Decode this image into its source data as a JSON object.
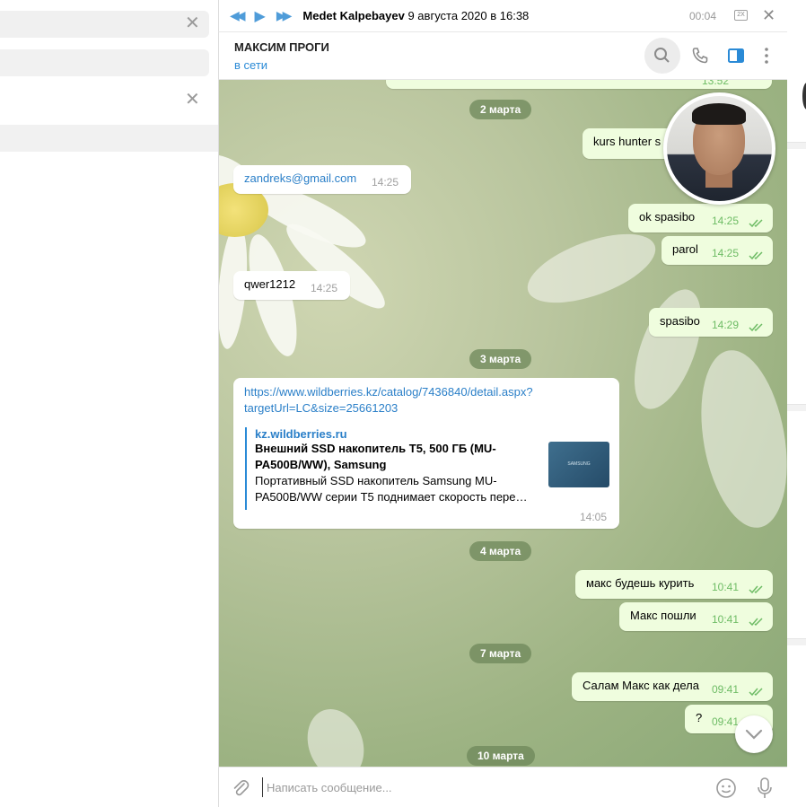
{
  "audio": {
    "sender": "Medet Kalpebayev",
    "date": "9 августа 2020 в 16:38",
    "time": "00:04",
    "speed": "2X"
  },
  "chat": {
    "name": "МАКСИМ ПРОГИ",
    "status": "в сети"
  },
  "dates": {
    "d1": "2 марта",
    "d2": "3 марта",
    "d3": "4 марта",
    "d4": "7 марта",
    "d5": "10 марта"
  },
  "messages": {
    "m0_time": "13:52",
    "m1": {
      "text": "kurs hunter s",
      "time": ""
    },
    "m2": {
      "text": "zandreks@gmail.com",
      "time": "14:25"
    },
    "m3": {
      "text": "ok  spasibo",
      "time": "14:25"
    },
    "m4": {
      "text": "parol",
      "time": "14:25"
    },
    "m5": {
      "text": "qwer1212",
      "time": "14:25"
    },
    "m6": {
      "text": "spasibo",
      "time": "14:29"
    },
    "m7": {
      "url_line1": "https://www.wildberries.kz/catalog/7436840/detail.aspx?",
      "url_line2": "targetUrl=LC&size=25661203",
      "site": "kz.wildberries.ru",
      "title": "Внешний SSD накопитель T5, 500 ГБ (MU-PA500B/WW), Samsung",
      "desc": "Портативный SSD накопитель Samsung MU-PA500B/WW серии T5 поднимает скорость пере…",
      "img_label": "SAMSUNG",
      "time": "14:05"
    },
    "m8": {
      "text": "макс будешь курить",
      "time": "10:41"
    },
    "m9": {
      "text": "Макс пошли",
      "time": "10:41"
    },
    "m10": {
      "text": "Салам Макс как дела",
      "time": "09:41"
    },
    "m11": {
      "text": "?",
      "time": "09:41"
    }
  },
  "composer": {
    "placeholder": "Написать сообщение..."
  },
  "icons": {
    "accent": "#4f9cd9",
    "link": "#2a7fc8",
    "out_bubble": "#effdde",
    "ticks": "#6ebc65"
  }
}
